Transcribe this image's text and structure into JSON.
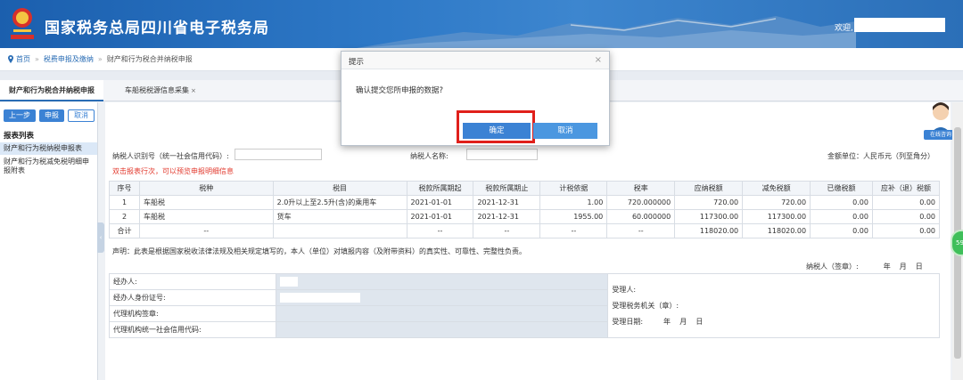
{
  "header": {
    "site_title": "国家税务总局四川省电子税务局",
    "welcome": "欢迎,",
    "brand_colors": {
      "primary": "#2a6db5",
      "alert": "#e23a2e",
      "highlight": "#e0201b"
    }
  },
  "breadcrumb": {
    "home": "首页",
    "sep": "»",
    "link": "税费申报及缴纳",
    "current": "财产和行为税合并纳税申报"
  },
  "tabs": [
    {
      "label": "财产和行为税合并纳税申报"
    },
    {
      "label": "车船税税源信息采集",
      "close": "×"
    }
  ],
  "sidebar": {
    "buttons": {
      "prev": "上一步",
      "submit": "申报",
      "cancel": "取消"
    },
    "list_title": "报表列表",
    "items": [
      {
        "label": "财产和行为税纳税申报表"
      },
      {
        "label": "财产和行为税减免税明细申报附表"
      }
    ],
    "handle": "‹"
  },
  "main": {
    "taxid_label": "纳税人识别号（统一社会信用代码）:",
    "name_label": "纳税人名称:",
    "unit_label": "金额单位：人民币元（列至角分）",
    "hint": "双击报表行次，可以预览申报明细信息",
    "columns": [
      "序号",
      "税种",
      "税目",
      "税款所属期起",
      "税款所属期止",
      "计税依据",
      "税率",
      "应纳税额",
      "减免税额",
      "已缴税额",
      "应补（退）税额"
    ],
    "rows": [
      [
        "1",
        "车船税",
        "2.0升以上至2.5升(含)的乘用车",
        "2021-01-01",
        "2021-12-31",
        "1.00",
        "720.000000",
        "720.00",
        "720.00",
        "0.00",
        "0.00"
      ],
      [
        "2",
        "车船税",
        "货车",
        "2021-01-01",
        "2021-12-31",
        "1955.00",
        "60.000000",
        "117300.00",
        "117300.00",
        "0.00",
        "0.00"
      ]
    ],
    "total_row": [
      "合计",
      "--",
      "",
      "--",
      "--",
      "--",
      "--",
      "118020.00",
      "118020.00",
      "0.00",
      "0.00"
    ],
    "statement": "声明：此表是根据国家税收法律法规及相关规定填写的，本人（单位）对填报内容（及附带资料）的真实性、可靠性、完整性负责。",
    "taxpayer_sign": "纳税人（签章）:",
    "year": "年",
    "month": "月",
    "day": "日",
    "agent": {
      "operator": "经办人:",
      "operator_id": "经办人身份证号:",
      "agency_seal": "代理机构签章:",
      "agency_code": "代理机构统一社会信用代码:",
      "acceptor": "受理人:",
      "accept_office": "受理税务机关（章）:",
      "accept_date": "受理日期:"
    }
  },
  "side": {
    "online": "在线咨询",
    "badge": "59"
  },
  "dialog": {
    "title": "提示",
    "close": "×",
    "message": "确认提交您所申报的数据?",
    "ok": "确定",
    "cancel": "取消"
  }
}
